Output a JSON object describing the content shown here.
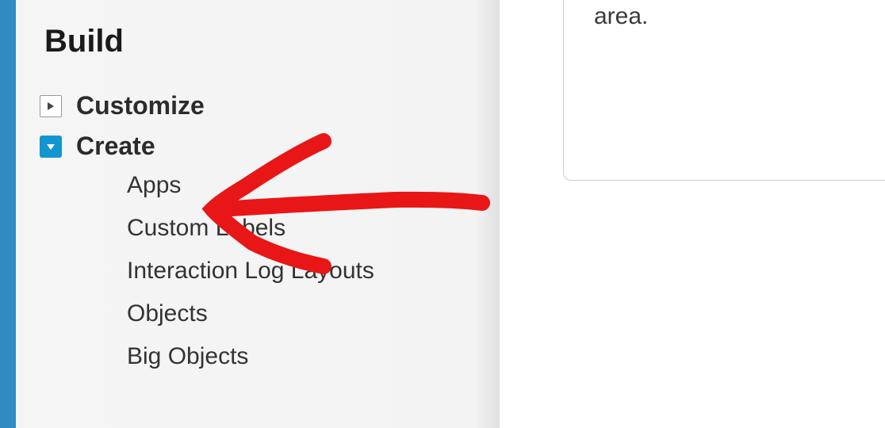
{
  "sidebar": {
    "section_title": "Build",
    "items": [
      {
        "label": "Customize",
        "expanded": false
      },
      {
        "label": "Create",
        "expanded": true
      }
    ],
    "create_submenu": [
      {
        "label": "Apps"
      },
      {
        "label": "Custom Labels"
      },
      {
        "label": "Interaction Log Layouts"
      },
      {
        "label": "Objects"
      },
      {
        "label": "Big Objects"
      }
    ]
  },
  "main": {
    "visible_text": "area."
  }
}
